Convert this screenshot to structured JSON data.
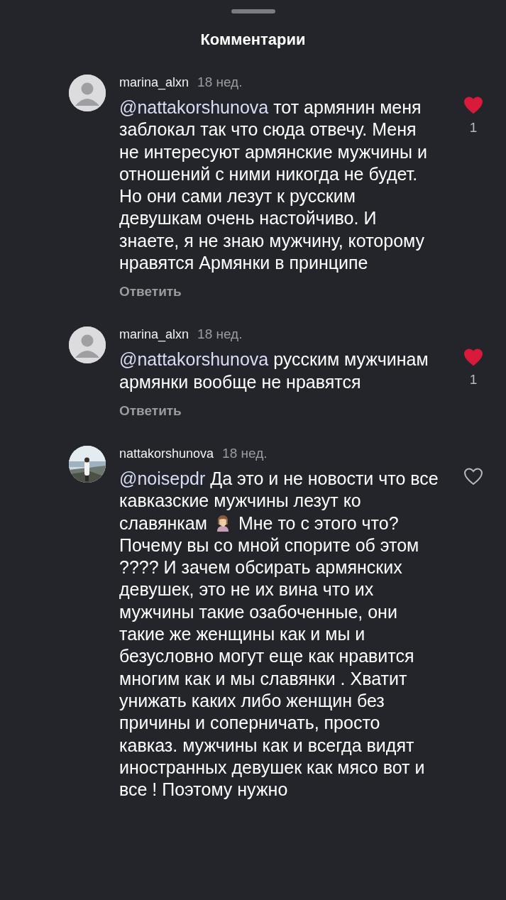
{
  "title": "Комментарии",
  "comments": [
    {
      "avatar": {
        "kind": "placeholder"
      },
      "username": "marina_alxn",
      "time": "18 нед.",
      "liked": true,
      "likes": "1",
      "reply": "Ответить",
      "body": [
        {
          "kind": "mention",
          "text": "@nattakorshunova"
        },
        {
          "kind": "text",
          "text": "тот армянин меня заблокал так что сюда отвечу. Меня не интересуют армянские мужчины и отношений с ними никогда не будет. Но они сами лезут к русским девушкам очень настойчиво. И знаете, я не знаю мужчину, которому нравятся Армянки в принципе"
        }
      ]
    },
    {
      "avatar": {
        "kind": "placeholder"
      },
      "username": "marina_alxn",
      "time": "18 нед.",
      "liked": true,
      "likes": "1",
      "reply": "Ответить",
      "body": [
        {
          "kind": "mention",
          "text": "@nattakorshunova"
        },
        {
          "kind": "text",
          "text": "русским мужчинам армянки вообще не нравятся"
        }
      ]
    },
    {
      "username": "nattakorshunova",
      "time": "18 нед.",
      "liked": false,
      "body": [
        {
          "kind": "mention",
          "text": "@noisepdr"
        },
        {
          "kind": "text",
          "text": "Да это и не новости что все кавказские мужчины лезут ко славянкам"
        },
        {
          "kind": "emoji"
        },
        {
          "kind": "text",
          "text": "Мне то с этого что? Почему вы со мной спорите об этом ???? И зачем обсирать армянских девушек, это не их вина что их мужчины такие озабоченные, они такие же женщины как и мы и безусловно могут еще как нравится многим как и мы славянки . Хватит унижать каких либо женщин без причины и соперничать, просто кавказ. мужчины как и всегда видят иностранных девушек как мясо вот и все ! Поэтому нужно"
        }
      ]
    }
  ]
}
